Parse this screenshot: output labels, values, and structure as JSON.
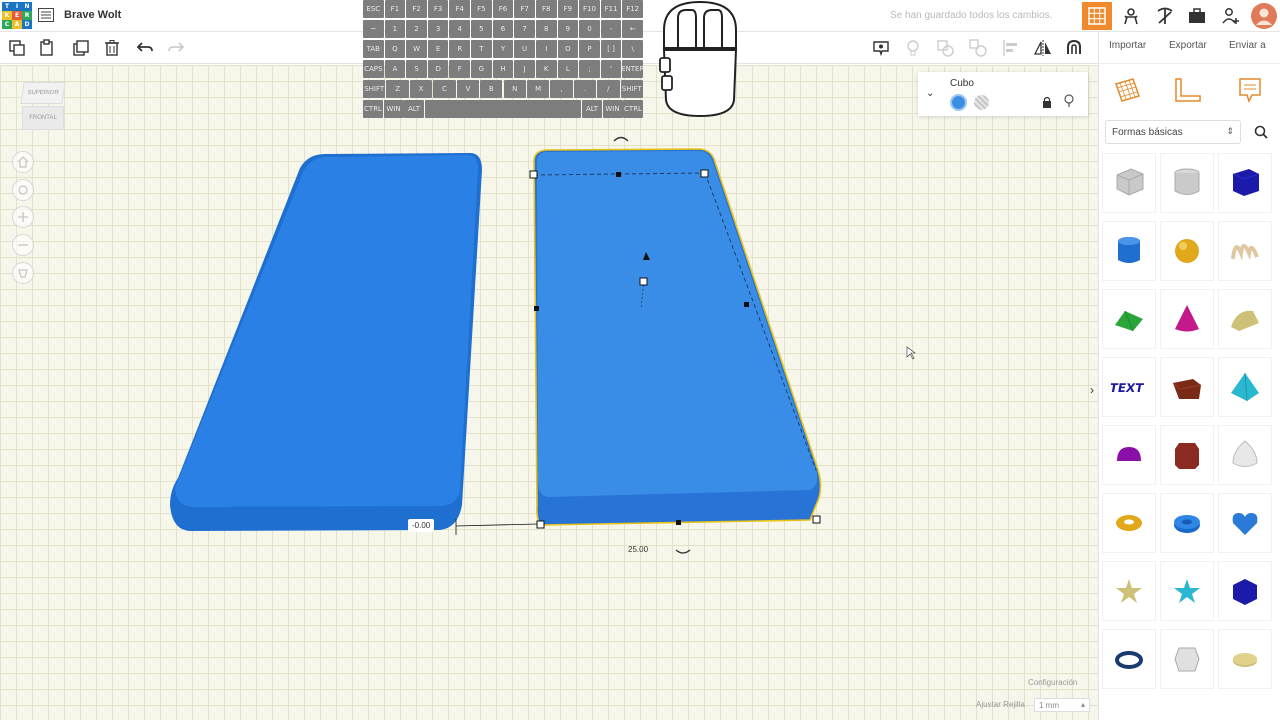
{
  "app": {
    "logo_letters": [
      "T",
      "I",
      "N",
      "K",
      "E",
      "R",
      "C",
      "A",
      "D"
    ],
    "project_name": "Brave Wolt",
    "saved_status": "Se han guardado todos los cambios."
  },
  "right_tabs": {
    "import": "Importar",
    "export": "Exportar",
    "send": "Enviar a"
  },
  "shape_panel": {
    "title": "Cubo",
    "solid_color": "#3a8fe3",
    "hole_color": "#b8b8b8"
  },
  "library": {
    "selected": "Formas básicas",
    "shapes": [
      "box-icon",
      "cylinder-gray-icon",
      "cube-blue-icon",
      "cylinder-blue-icon",
      "sphere-icon",
      "scribble-icon",
      "roof-icon",
      "cone-icon",
      "round-roof-icon",
      "text-icon",
      "wedge-icon",
      "pyramid-icon",
      "half-sphere-icon",
      "polygon-icon",
      "paraboloid-icon",
      "torus-icon",
      "tube-icon",
      "heart-icon",
      "star-icon",
      "star-blue-icon",
      "icosahedron-icon",
      "ring-icon",
      "hexagon-icon",
      "pill-icon"
    ]
  },
  "viewcube": {
    "top": "SUPERIOR",
    "front": "FRONTAL"
  },
  "dimensions": {
    "offset": "-0.00",
    "width": "25.00"
  },
  "bottom": {
    "config": "Configuración",
    "snap_label": "Ajustar Rejilla",
    "snap_value": "1 mm"
  },
  "keyboard": {
    "row1": [
      "ESC",
      "F1",
      "F2",
      "F3",
      "F4",
      "F5",
      "F6",
      "F7",
      "F8",
      "F9",
      "F10",
      "F11",
      "F12"
    ],
    "row2": [
      "~",
      "1",
      "2",
      "3",
      "4",
      "5",
      "6",
      "7",
      "8",
      "9",
      "0",
      "-",
      "←"
    ],
    "row3": [
      "TAB",
      "Q",
      "W",
      "E",
      "R",
      "T",
      "Y",
      "U",
      "I",
      "O",
      "P",
      "[ ]",
      "\\"
    ],
    "row4": [
      "CAPS",
      "A",
      "S",
      "D",
      "F",
      "G",
      "H",
      "J",
      "K",
      "L",
      ";",
      "'",
      "ENTER"
    ],
    "row5": [
      "SHIFT",
      "Z",
      "X",
      "C",
      "V",
      "B",
      "N",
      "M",
      ",",
      ".",
      "/",
      "SHIFT"
    ],
    "row6": [
      "CTRL",
      "WIN",
      "ALT",
      "ALT",
      "WIN",
      "CTRL"
    ]
  },
  "colors": {
    "accent": "#f08a2e",
    "shape_blue": "#2b80e4",
    "selection": "#e8c21a"
  }
}
